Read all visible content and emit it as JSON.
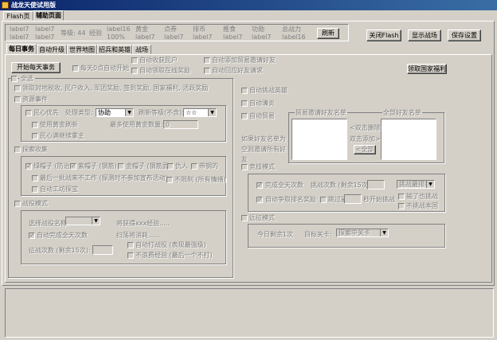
{
  "app": {
    "title": "战龙天使试用版"
  },
  "top_tabs": [
    {
      "label": "Flash页面"
    },
    {
      "label": "辅助页面"
    }
  ],
  "status_bar": {
    "labels": [
      "label7",
      "label7",
      "等级: 44",
      "经验",
      "label16",
      "黄金",
      "点券",
      "排币",
      "推食",
      "功勋",
      "总战力"
    ],
    "values": [
      "label7",
      "label7",
      "",
      "",
      "100%",
      "label7",
      "label7",
      "label7",
      "label7",
      "label7",
      "label16"
    ],
    "refresh_button": "刷新"
  },
  "header_buttons": {
    "close_flash": "关闭Flash",
    "show_battle": "显示战场",
    "save_settings": "保存设置"
  },
  "sub_tabs": [
    {
      "label": "每日事务"
    },
    {
      "label": "自动升级"
    },
    {
      "label": "世界地图"
    },
    {
      "label": "招兵和英雄"
    },
    {
      "label": "战场"
    }
  ],
  "daily": {
    "start_button": "开始每天事务",
    "auto_start_0": "每天0点自动开始",
    "auto_collect_residents": "自动收获民户",
    "auto_reward_online": "自动领取在线奖励",
    "auto_add_trade_friends": "自动添加贸易邀请好友",
    "auto_reply_friend_requests": "自动回应好友请求",
    "national_welfare_button": "领取国家福利",
    "all_label": "全选",
    "collect_items": "领取封地税收, 民户收入, 军团奖励, 签到奖励, 国家福利, 活跃奖励",
    "resource_events": "资源事件",
    "mood_priority": "民心优先",
    "process_type_label": "处理类型:",
    "process_type_value": "协助",
    "refresh_level_label": "刷新等级(不含):",
    "refresh_level_value": "☆☆",
    "use_gold_refresh": "使用黄金刷新",
    "max_gold_label": "最多使用黄金数量:",
    "max_gold_value": "0",
    "mood_full_stop": "民心满继续拿主",
    "treasure_hunt": "探索收集",
    "hat_red": "绿帽子 (防治)",
    "hat_purple": "紫帽子 (钢筋)",
    "hat_gold": "金帽子 (钢筋武)",
    "hat_hero": "仇人",
    "hat_wood": "带钢的",
    "last_batch": "最后一批战来不工作 (探测时不参加宣布活动)",
    "no_limit": "不限制 (所有情绪)",
    "auto_work_confirm": "自动工坊探宝",
    "battle_mode": "战役模式",
    "choose_battle_label": "选择战役名称",
    "gain_exp_label": "将获得xxx经验.....",
    "auto_finish_all": "自动完成全天次数",
    "sweep_consume": "扫荡将消耗......",
    "battle_count_label": "征战次数 (剩余15次):",
    "auto_hit_enemy": "自动打战役 (表现最强级)",
    "no_exp_waste": "不浪费经验 (最后一个不打)",
    "auto_challenge": "自动挑战英雄",
    "auto_check_exp": "自动清炎",
    "auto_trade": "自动贸易",
    "trade_friends_title": "贸易邀请好友名单",
    "all_friends_title": "全部好友名单",
    "dbl_click_remove": "<双击删除",
    "dbl_click_add": "双击添加>",
    "all_button": "<全部",
    "empty_friend_note": "如果好友名单为空则邀请所有好友",
    "competition_mode": "竞技模式",
    "finish_day_count": "完成全天次数",
    "challenge_count_label": "挑战次数 (剩余15次):",
    "challenge_select": "挑战最排名",
    "auto_fight_rank": "自动争取排名奖励",
    "auto_open": "跳过前",
    "seconds_start": "秒开始挑战",
    "lose_challenge": "输了也挑战",
    "no_challenge_same": "不挑战本国",
    "rescue_mode": "远征模式",
    "today_left": "今日剩余1次",
    "target_level_label": "目标关卡:",
    "target_level_value": "探索中关卡"
  },
  "colors": {
    "title_bg_start": "#0a246a",
    "title_bg_end": "#3a6ea5",
    "face": "#d4d0c8"
  }
}
